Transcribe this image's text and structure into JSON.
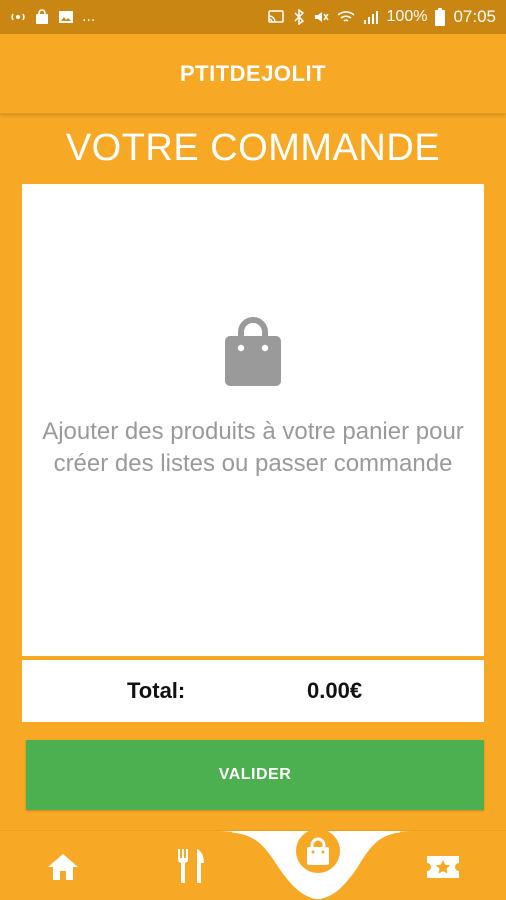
{
  "status_bar": {
    "left_ellipsis": "...",
    "battery_text": "100%",
    "time": "07:05",
    "icons": [
      "hotspot-icon",
      "shopping-bag-icon",
      "image-icon",
      "cast-icon",
      "bluetooth-icon",
      "mute-icon",
      "wifi-icon",
      "signal-icon",
      "battery-icon"
    ]
  },
  "app_bar": {
    "title": "PTITDEJOLIT"
  },
  "page": {
    "heading": "VOTRE COMMANDE"
  },
  "cart": {
    "empty_icon": "shopping-bag-icon",
    "empty_message": "Ajouter des produits à votre panier pour créer des listes ou passer commande"
  },
  "total": {
    "label": "Total:",
    "value": "0.00€"
  },
  "actions": {
    "validate_label": "VALIDER"
  },
  "bottom_nav": {
    "items": [
      {
        "icon": "home-icon"
      },
      {
        "icon": "fork-knife-icon"
      },
      {
        "icon": "shopping-bag-icon",
        "active": true
      },
      {
        "icon": "ticket-star-icon"
      }
    ]
  },
  "colors": {
    "primary": "#F7A825",
    "status_bar": "#C98613",
    "button_green": "#4CAF50",
    "muted_text": "#9A9A9A"
  }
}
